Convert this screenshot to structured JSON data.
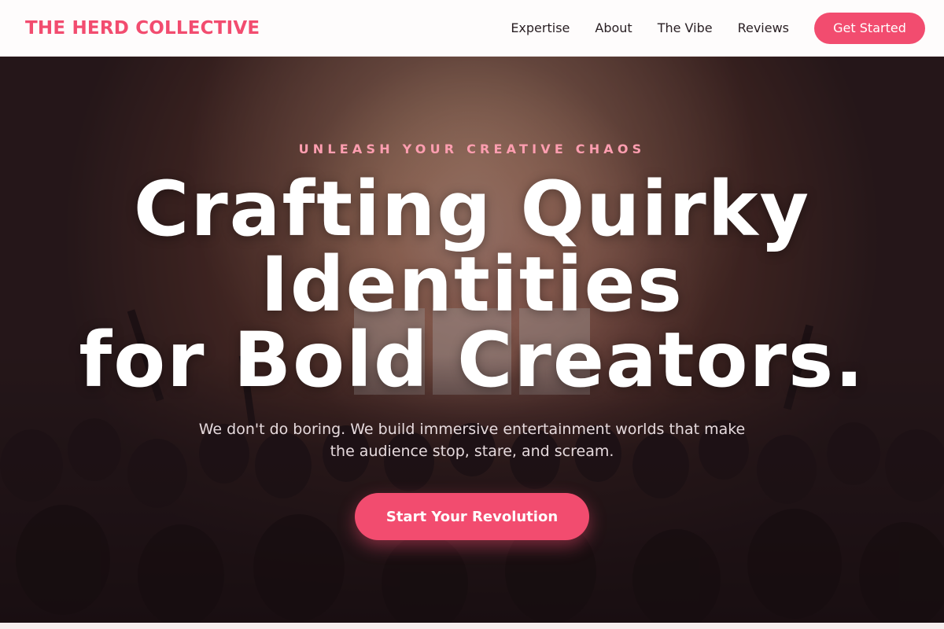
{
  "nav": {
    "brand": "THE HERD COLLECTIVE",
    "links": [
      "Expertise",
      "About",
      "The Vibe",
      "Reviews"
    ],
    "cta": "Get Started"
  },
  "hero": {
    "eyebrow": "UNLEASH YOUR CREATIVE CHAOS",
    "headline_lines": [
      "Crafting Quirky",
      "Identities",
      "for Bold Creators."
    ],
    "subtext": "We don't do boring. We build immersive entertainment worlds that make the audience stop, stare, and scream.",
    "cta": "Start Your Revolution",
    "background_image": "concert-crowd-photo"
  },
  "colors": {
    "accent": "#f24c6f",
    "eyebrow": "#ff9eb0",
    "nav_text": "#2a2024",
    "page_bg": "#f6eeee"
  }
}
